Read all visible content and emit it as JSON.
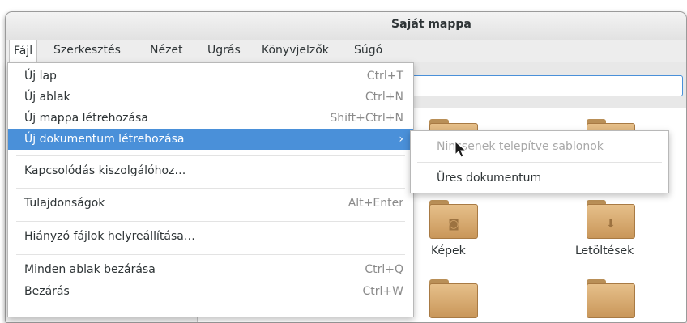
{
  "window": {
    "title": "Saját mappa"
  },
  "menubar": {
    "items": [
      "Fájl",
      "Szerkesztés",
      "Nézet",
      "Ugrás",
      "Könyvjelzők",
      "Súgó"
    ]
  },
  "file_menu": {
    "items": [
      {
        "label": "Új lap",
        "accel": "Ctrl+T"
      },
      {
        "label": "Új ablak",
        "accel": "Ctrl+N"
      },
      {
        "label": "Új mappa létrehozása",
        "accel": "Shift+Ctrl+N"
      },
      {
        "label": "Új dokumentum létrehozása",
        "accel": "›"
      },
      {
        "label": "Kapcsolódás kiszolgálóhoz…",
        "accel": ""
      },
      {
        "label": "Tulajdonságok",
        "accel": "Alt+Enter"
      },
      {
        "label": "Hiányzó fájlok helyreállítása…",
        "accel": ""
      },
      {
        "label": "Minden ablak bezárása",
        "accel": "Ctrl+Q"
      },
      {
        "label": "Bezárás",
        "accel": "Ctrl+W"
      }
    ]
  },
  "submenu": {
    "items": [
      {
        "label": "Nincsenek telepítve sablonok",
        "disabled": true
      },
      {
        "label": "Üres dokumentum",
        "disabled": false
      }
    ]
  },
  "folders": [
    {
      "label": "",
      "icon": "folder-icon"
    },
    {
      "label": "",
      "icon": "folder-icon"
    },
    {
      "label": "Képek",
      "icon": "pictures-folder-icon"
    },
    {
      "label": "Letöltések",
      "icon": "downloads-folder-icon"
    },
    {
      "label": "",
      "icon": "folder-icon"
    },
    {
      "label": "",
      "icon": "folder-icon"
    }
  ],
  "colors": {
    "selection": "#4a90d9",
    "folder": "#d9ae72"
  }
}
